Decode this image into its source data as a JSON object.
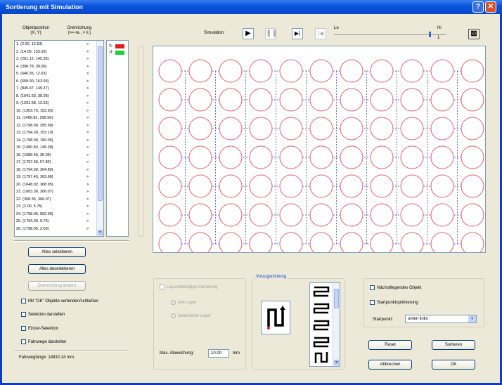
{
  "window": {
    "title": "Sortierung mit Simulation",
    "help": "?",
    "close": "✕"
  },
  "list": {
    "col1": "Objektposition\n(X, Y)",
    "col2": "Drehrichtung\n(>= re., < li.)",
    "items": [
      "1. (2.00, 12.63)",
      "2. (14.05, 153.93)",
      "3. (201.12, 145.36)",
      "4. (396.78, 30.06)",
      "5. (646.95, 12.63)",
      "6. (658.90, 153.93)",
      "7. (845.97, 145.37)",
      "8. (1041.63, 30.06)",
      "9. (1291.68, 12.63)",
      "10. (1303.75, 153.93)",
      "11. (1490.82, 206.50)",
      "12. (1798.00, 255.58)",
      "13. (1794.30, 153.10)",
      "14. (1798.00, 150.05)",
      "15. (1490.83, 145.38)",
      "16. (1686.45, 30.06)",
      "17. (1797.66, 57.82)",
      "18. (1794.30, 364.80)",
      "19. (1797.45, 363.68)",
      "20. (1648.02, 368.95)",
      "21. (1003.30, 306.07)",
      "22. (358.35, 306.07)",
      "23. (2.00, 5.75)",
      "24. (1798.05, 502.00)",
      "25. (1794.30, 5.75)",
      "26. (1798.05, 2.00)"
    ],
    "arrow": ">"
  },
  "buttons": {
    "select_all": "Alles selektieren",
    "deselect_all": "Alles deselektieren",
    "change_rotation": "Drehrichtung ändern",
    "reset": "Reset",
    "sort": "Sortieren",
    "cancel": "Abbrechen",
    "ok": "OK"
  },
  "checkboxes": {
    "ok_objects": "Mit \"OK\" Objekte verbinden/schließen",
    "show_selection": "Selektion darstellen",
    "single_selection": "Einzel-Selektion",
    "show_paths": "Fahrwege darstellen",
    "layer_sort": "Layerabhängige Sortierung",
    "nearest_object": "Nächstliegendes Objekt",
    "start_opt": "Startpunktoptimierung"
  },
  "travel": "Fahrweglänge: 14832.24 mm",
  "simulation": {
    "label": "Simulation:",
    "lo": "Lo",
    "hi": "Hi",
    "speed_value": "1",
    "speed": 0.85
  },
  "radios": {
    "all_layers": "Alle Layer",
    "selected_layer": "Selektierter Layer"
  },
  "deviation": {
    "label": "Max. Abweichung:",
    "value": "10.00",
    "unit": "mm"
  },
  "preferred_direction": "Vorzugsrichtung",
  "startpoint": {
    "label": "Startpunkt:",
    "value": "unten links"
  },
  "grid": {
    "cols": 11,
    "rows": 7,
    "circle_color": "#e06070",
    "path_color": "#6070d8"
  },
  "colors": {
    "swatch_red": "#e02020",
    "swatch_green": "#20d040"
  }
}
